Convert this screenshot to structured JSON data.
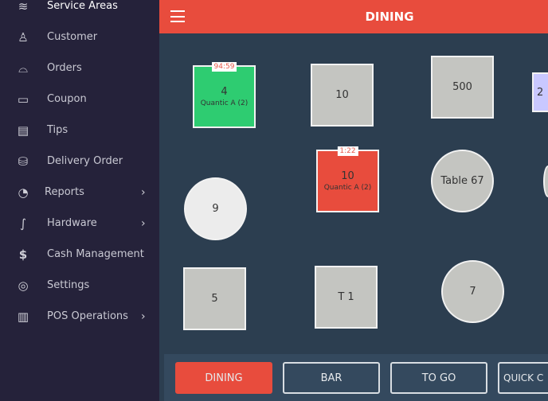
{
  "sidebar": {
    "items": [
      {
        "label": "Service Areas",
        "icon": "layers-icon",
        "active": true
      },
      {
        "label": "Customer",
        "icon": "user-icon"
      },
      {
        "label": "Orders",
        "icon": "cloche-icon"
      },
      {
        "label": "Coupon",
        "icon": "coupon-icon"
      },
      {
        "label": "Tips",
        "icon": "cash-icon"
      },
      {
        "label": "Delivery Order",
        "icon": "bag-icon"
      },
      {
        "label": "Reports",
        "icon": "report-icon",
        "chevron": true
      },
      {
        "label": "Hardware",
        "icon": "cable-icon",
        "chevron": true
      },
      {
        "label": "Cash Management",
        "icon": "dollar-icon"
      },
      {
        "label": "Settings",
        "icon": "lifebuoy-icon"
      },
      {
        "label": "POS Operations",
        "icon": "pos-operations-icon",
        "chevron": true
      }
    ]
  },
  "header": {
    "title": "DINING",
    "menu_icon": "hamburger-icon",
    "color": "#e84c3d"
  },
  "tables": [
    {
      "name": "4",
      "sub": "Quantic A (2)",
      "timer": "94:59",
      "status": "occupied",
      "color": "#2ecc71"
    },
    {
      "name": "10",
      "color": "#c4c5c1"
    },
    {
      "name": "500",
      "color": "#c4c5c1"
    },
    {
      "name": "2",
      "color": "#c9c8ff"
    },
    {
      "name": "9",
      "color": "#ececec"
    },
    {
      "name": "10",
      "sub": "Quantic A (2)",
      "timer": "1:22",
      "status": "overdue",
      "color": "#e84c3d"
    },
    {
      "name": "Table 67",
      "color": "#c4c5c1"
    },
    {
      "name": "",
      "color": "#c4c5c1"
    },
    {
      "name": "5",
      "color": "#c4c5c1"
    },
    {
      "name": "T 1",
      "color": "#c4c5c1"
    },
    {
      "name": "7",
      "color": "#c4c5c1"
    }
  ],
  "tabs": [
    {
      "label": "DINING",
      "active": true
    },
    {
      "label": "BAR"
    },
    {
      "label": "TO GO"
    },
    {
      "label": "QUICK C"
    }
  ]
}
